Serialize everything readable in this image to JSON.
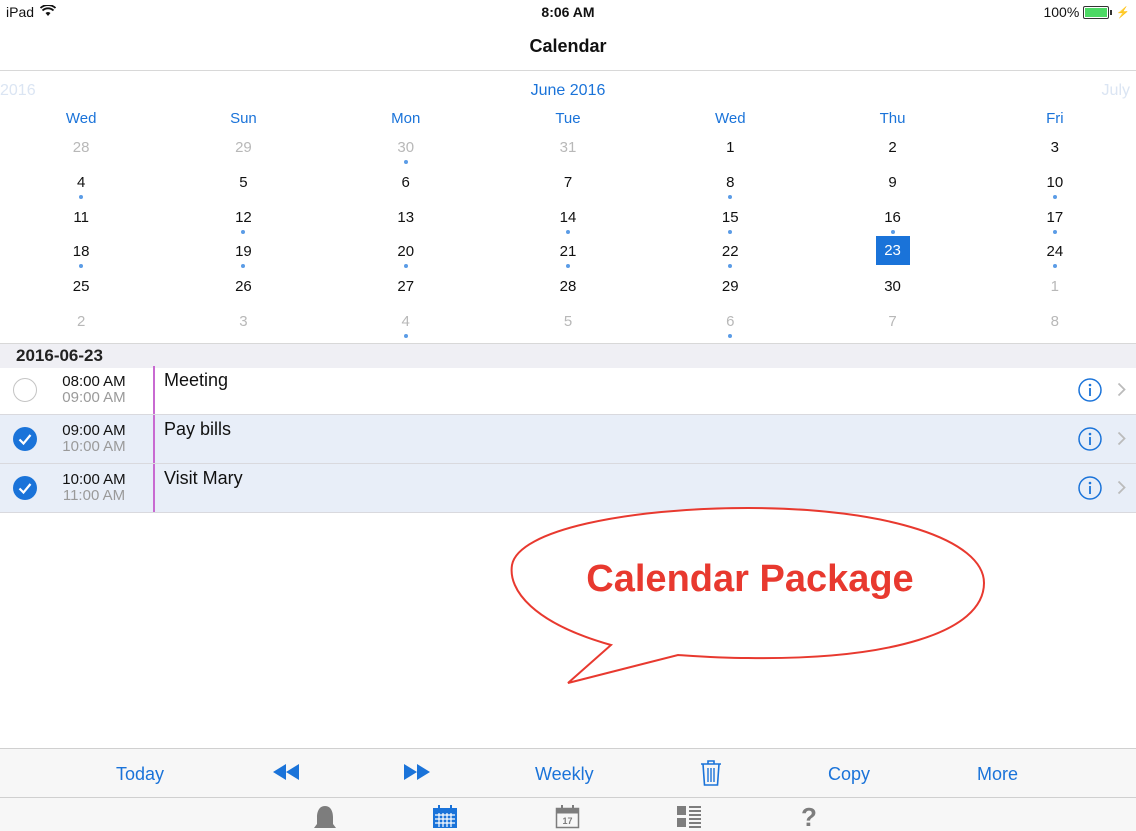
{
  "status_bar": {
    "device": "iPad",
    "time": "8:06 AM",
    "battery": "100%"
  },
  "nav": {
    "title": "Calendar"
  },
  "calendar": {
    "prev_month": "2016",
    "current_month": "June 2016",
    "next_month": "July",
    "weekdays": [
      "Wed",
      "Sun",
      "Mon",
      "Tue",
      "Wed",
      "Thu",
      "Fri"
    ],
    "weeks": [
      [
        {
          "d": "28",
          "o": true
        },
        {
          "d": "29",
          "o": true
        },
        {
          "d": "30",
          "o": true,
          "e": true
        },
        {
          "d": "31",
          "o": true
        },
        {
          "d": "1"
        },
        {
          "d": "2"
        },
        {
          "d": "3"
        }
      ],
      [
        {
          "d": "4",
          "e": true
        },
        {
          "d": "5"
        },
        {
          "d": "6"
        },
        {
          "d": "7"
        },
        {
          "d": "8",
          "e": true
        },
        {
          "d": "9"
        },
        {
          "d": "10",
          "e": true
        }
      ],
      [
        {
          "d": "11"
        },
        {
          "d": "12",
          "e": true
        },
        {
          "d": "13"
        },
        {
          "d": "14",
          "e": true
        },
        {
          "d": "15",
          "e": true
        },
        {
          "d": "16",
          "e": true
        },
        {
          "d": "17",
          "e": true
        }
      ],
      [
        {
          "d": "18",
          "e": true
        },
        {
          "d": "19",
          "e": true
        },
        {
          "d": "20",
          "e": true
        },
        {
          "d": "21",
          "e": true
        },
        {
          "d": "22",
          "e": true
        },
        {
          "d": "23",
          "s": true
        },
        {
          "d": "24",
          "e": true
        }
      ],
      [
        {
          "d": "25"
        },
        {
          "d": "26"
        },
        {
          "d": "27"
        },
        {
          "d": "28"
        },
        {
          "d": "29"
        },
        {
          "d": "30"
        },
        {
          "d": "1",
          "o": true
        }
      ],
      [
        {
          "d": "2",
          "o": true
        },
        {
          "d": "3",
          "o": true
        },
        {
          "d": "4",
          "o": true,
          "e": true
        },
        {
          "d": "5",
          "o": true
        },
        {
          "d": "6",
          "o": true,
          "e": true
        },
        {
          "d": "7",
          "o": true
        },
        {
          "d": "8",
          "o": true
        }
      ]
    ]
  },
  "list": {
    "date": "2016-06-23",
    "events": [
      {
        "start": "08:00 AM",
        "end": "09:00 AM",
        "title": "Meeting",
        "done": false
      },
      {
        "start": "09:00 AM",
        "end": "10:00 AM",
        "title": "Pay bills",
        "done": true
      },
      {
        "start": "10:00 AM",
        "end": "11:00 AM",
        "title": "Visit Mary",
        "done": true
      }
    ]
  },
  "callout": {
    "text": "Calendar Package",
    "color": "#e8392f"
  },
  "toolbar": {
    "today": "Today",
    "weekly": "Weekly",
    "copy": "Copy",
    "more": "More"
  },
  "tabbar": {
    "icons": [
      "bell-icon",
      "calendar-grid-icon",
      "calendar-day-icon",
      "list-icon",
      "help-icon"
    ],
    "tab_date": "17"
  },
  "colors": {
    "accent": "#1a73d9",
    "event_line": "#c86ad1"
  }
}
